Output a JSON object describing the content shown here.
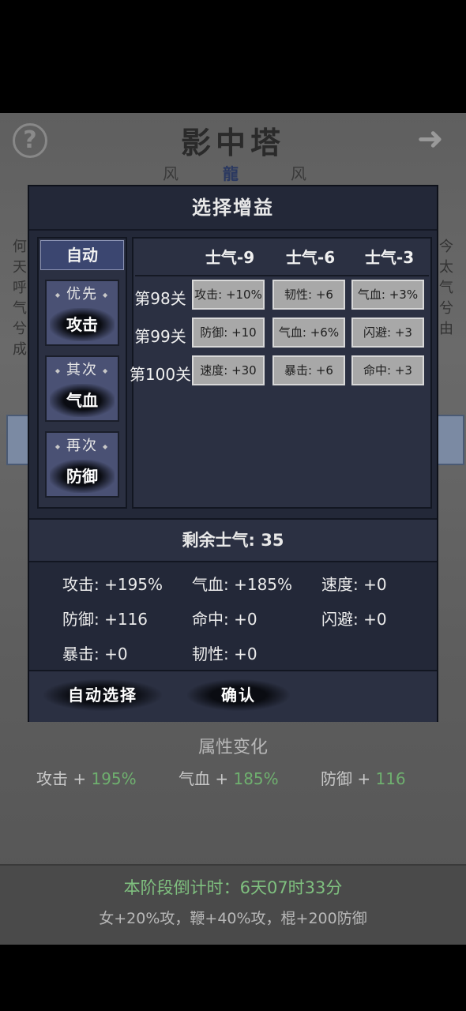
{
  "header": {
    "title": "影中塔",
    "tabs": [
      "风",
      "龍",
      "风"
    ]
  },
  "dialog": {
    "title": "选择增益",
    "auto": {
      "label": "自动",
      "priorities": [
        {
          "label": "优先",
          "value": "攻击"
        },
        {
          "label": "其次",
          "value": "气血"
        },
        {
          "label": "再次",
          "value": "防御"
        }
      ]
    },
    "columns": [
      "士气-9",
      "士气-6",
      "士气-3"
    ],
    "rows": [
      {
        "level": "第98关",
        "options": [
          "攻击: +10%",
          "韧性: +6",
          "气血: +3%"
        ]
      },
      {
        "level": "第99关",
        "options": [
          "防御: +10",
          "气血: +6%",
          "闪避: +3"
        ]
      },
      {
        "level": "第100关",
        "options": [
          "速度: +30",
          "暴击: +6",
          "命中: +3"
        ]
      }
    ],
    "remaining": "剩余士气: 35",
    "stats": [
      "攻击: +195%",
      "气血: +185%",
      "速度: +0",
      "防御: +116",
      "命中: +0",
      "闪避: +0",
      "暴击: +0",
      "韧性: +0"
    ],
    "buttons": {
      "auto_select": "自动选择",
      "confirm": "确认"
    }
  },
  "attributes": {
    "title": "属性变化",
    "items": [
      {
        "name": "攻击",
        "value": "195%"
      },
      {
        "name": "气血",
        "value": "185%"
      },
      {
        "name": "防御",
        "value": "116"
      }
    ]
  },
  "footer": {
    "countdown": "本阶段倒计时：6天07时33分",
    "bonus": "女+20%攻，鞭+40%攻，棍+200防御"
  },
  "colors": {
    "dialog_bg": "#232838",
    "accent_blue": "#3b4670",
    "value_green": "#6fb06f"
  }
}
